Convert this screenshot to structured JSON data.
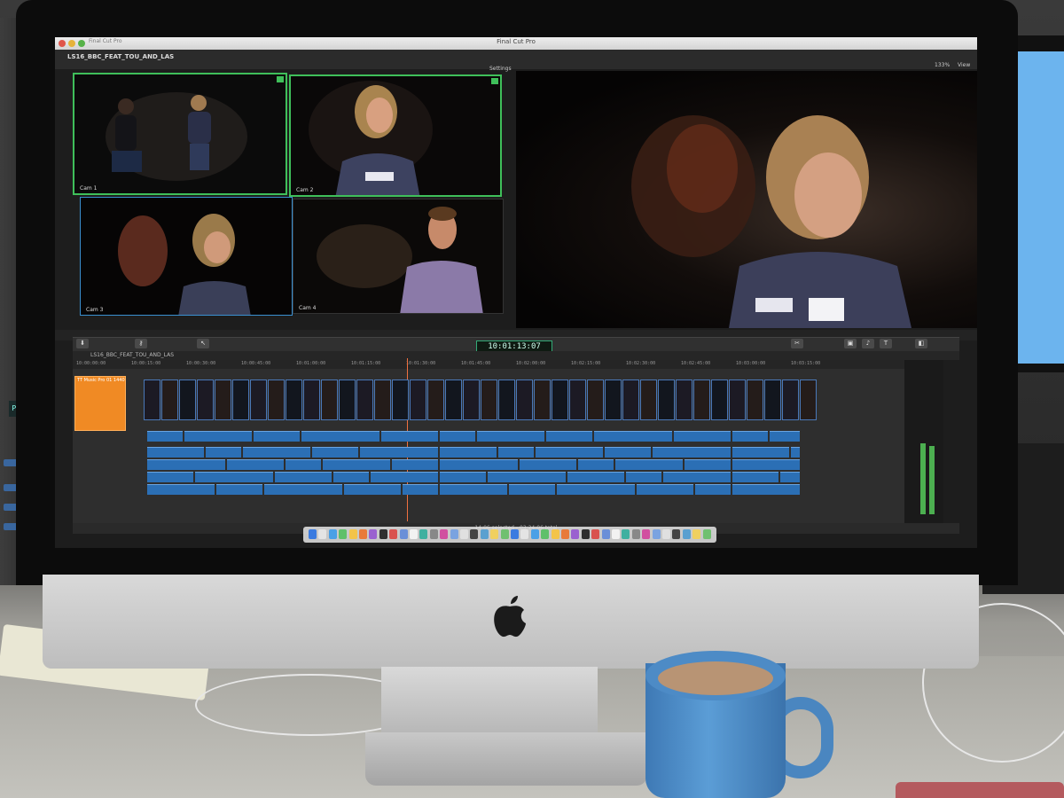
{
  "window": {
    "title": "Final Cut Pro",
    "app_small": "Final Cut Pro"
  },
  "project": {
    "name": "LS16_BBC_FEAT_TOU_AND_LAS",
    "settings_label": "Settings",
    "zoom": "133%",
    "view_label": "View"
  },
  "angles": [
    {
      "label": "Cam 1",
      "active": true
    },
    {
      "label": "Cam 2",
      "active": true
    },
    {
      "label": "Cam 3",
      "active": false
    },
    {
      "label": "Cam 4",
      "active": false
    }
  ],
  "timeline": {
    "project_name": "LS16_BBC_FEAT_TOU_AND_LAS",
    "timecode": "10:01:13:07",
    "ruler_ticks": [
      "10:00:00:00",
      "10:00:15:00",
      "10:00:30:00",
      "10:00:45:00",
      "10:01:00:00",
      "10:01:15:00",
      "10:01:30:00",
      "10:01:45:00",
      "10:02:00:00",
      "10:02:15:00",
      "10:02:30:00",
      "10:02:45:00",
      "10:03:00:00",
      "10:03:15:00"
    ],
    "multicam_clip_label": "TT Music Pro 01 1440",
    "status": "14:06 selected - 03:24:06 total",
    "meter_levels": [
      0.5,
      0.48
    ],
    "meter_scale": [
      "12",
      "6",
      "0",
      "-6",
      "-12",
      "-20",
      "-30",
      "-40",
      "-50"
    ]
  },
  "colors": {
    "accent_green": "#3fbf5a",
    "angle_blue": "#3a8fd0",
    "multicam_orange": "#f08a24",
    "audio_blue": "#2b6fb5",
    "playhead": "#f07040"
  }
}
